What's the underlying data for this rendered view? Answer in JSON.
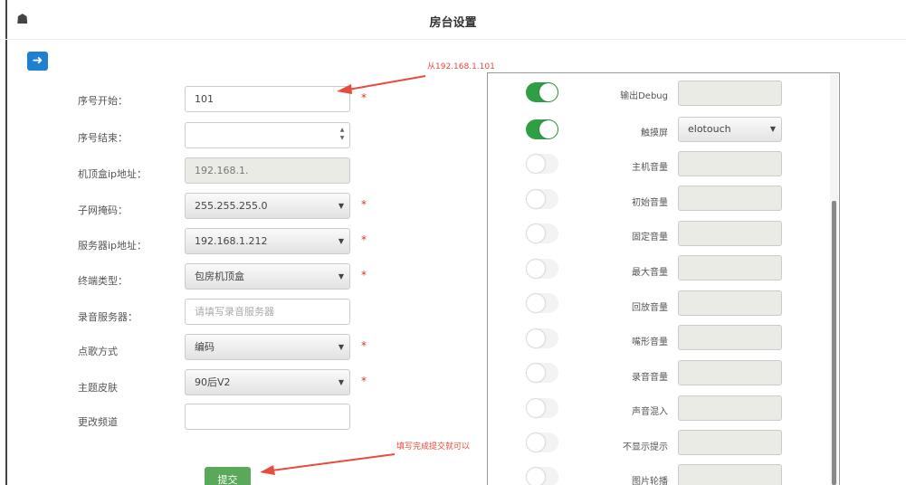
{
  "header": {
    "title": "房台设置",
    "home_icon": "home-icon",
    "back_icon": "arrow-left-icon"
  },
  "form": {
    "fields": [
      {
        "label": "序号开始：",
        "value": "101",
        "type": "text",
        "required": true
      },
      {
        "label": "序号结束：",
        "value": "",
        "type": "number",
        "required": false
      },
      {
        "label": "机顶盒ip地址：",
        "value": "192.168.1.",
        "type": "readonly",
        "required": false
      },
      {
        "label": "子网掩码：",
        "value": "255.255.255.0",
        "type": "select",
        "required": true
      },
      {
        "label": "服务器ip地址：",
        "value": "192.168.1.212",
        "type": "select",
        "required": true
      },
      {
        "label": "终端类型：",
        "value": "包房机顶盒",
        "type": "select",
        "required": true
      },
      {
        "label": "录音服务器：",
        "placeholder": "请填写录音服务器",
        "type": "text",
        "required": false
      },
      {
        "label": "点歌方式",
        "value": "编码",
        "type": "select",
        "required": true
      },
      {
        "label": "主题皮肤",
        "value": "90后V2",
        "type": "select",
        "required": true
      },
      {
        "label": "更改频道",
        "value": "",
        "type": "text",
        "required": false
      }
    ],
    "required_mark": "*",
    "submit_label": "提交"
  },
  "annotations": {
    "start_hint": "从192.168.1.101",
    "submit_hint": "填写完成提交就可以"
  },
  "settings": [
    {
      "label": "输出Debug",
      "on": true,
      "control": "input",
      "value": ""
    },
    {
      "label": "触摸屏",
      "on": true,
      "control": "select",
      "value": "elotouch"
    },
    {
      "label": "主机音量",
      "on": false,
      "control": "input",
      "value": ""
    },
    {
      "label": "初始音量",
      "on": false,
      "control": "input",
      "value": ""
    },
    {
      "label": "固定音量",
      "on": false,
      "control": "input",
      "value": ""
    },
    {
      "label": "最大音量",
      "on": false,
      "control": "input",
      "value": ""
    },
    {
      "label": "回放音量",
      "on": false,
      "control": "input",
      "value": ""
    },
    {
      "label": "嘴形音量",
      "on": false,
      "control": "input",
      "value": ""
    },
    {
      "label": "录音音量",
      "on": false,
      "control": "input",
      "value": ""
    },
    {
      "label": "声音混入",
      "on": false,
      "control": "input",
      "value": ""
    },
    {
      "label": "不显示提示",
      "on": false,
      "control": "input",
      "value": ""
    },
    {
      "label": "图片轮播",
      "on": false,
      "control": "input",
      "value": ""
    }
  ],
  "colors": {
    "accent_blue": "#1f7fd0",
    "toggle_on": "#2f9e44",
    "submit": "#5aa85a",
    "annotation": "#e74c3c"
  }
}
